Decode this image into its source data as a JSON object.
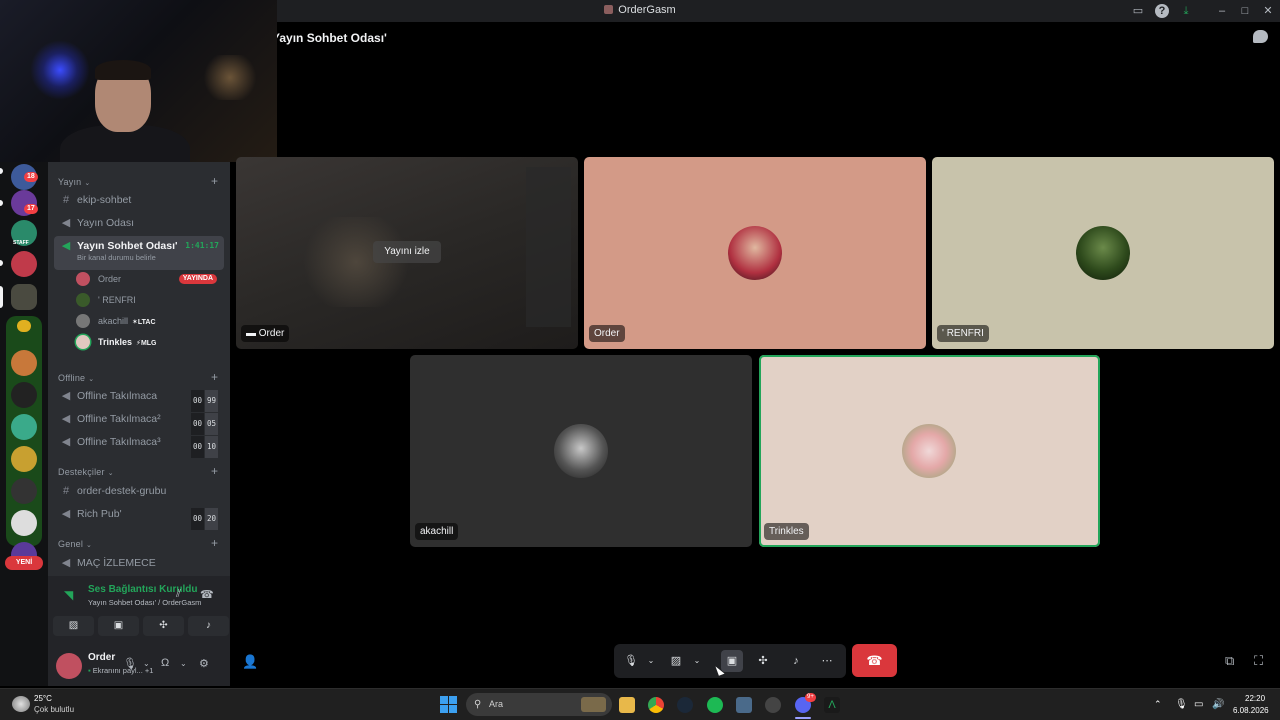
{
  "window": {
    "title": "OrderGasm"
  },
  "voice_header": {
    "channel": "Yayın Sohbet Odası'"
  },
  "sidebar": {
    "categories": [
      {
        "label": "Yayın"
      },
      {
        "label": "Offline"
      },
      {
        "label": "Destekçiler"
      },
      {
        "label": "Genel"
      }
    ],
    "channels": {
      "ekip_sohbet": "ekip-sohbet",
      "yayin_odasi": "Yayın Odası",
      "yayin_sohbet": "Yayın Sohbet Odası'",
      "yayin_sohbet_timer": "1:41:17",
      "yayin_sohbet_status": "Bir kanal durumu belirle",
      "offline1": "Offline Takılmaca",
      "offline2": "Offline Takılmaca²",
      "offline3": "Offline Takılmaca³",
      "order_destek": "order-destek-grubu",
      "rich_pub": "Rich Pub'",
      "mac": "MAÇ İZLEMECE"
    },
    "limits": {
      "offline1": [
        "00",
        "99"
      ],
      "offline2": [
        "00",
        "05"
      ],
      "offline3": [
        "00",
        "10"
      ],
      "rich_pub": [
        "00",
        "20"
      ]
    },
    "voice_users": [
      {
        "name": "Order",
        "badge": "YAYINDA"
      },
      {
        "name": "' RENFRI",
        "badge": ""
      },
      {
        "name": "akachill",
        "badge": "LTAC"
      },
      {
        "name": "Trinkles",
        "badge": "MLG"
      }
    ]
  },
  "servers": {
    "badges": [
      "18",
      "17"
    ],
    "new_label": "YENİ",
    "staff_label": "STAFF"
  },
  "voice_panel": {
    "status": "Ses Bağlantısı Kuruldu",
    "room": "Yayın Sohbet Odası' / OrderGasm"
  },
  "user_panel": {
    "name": "Order",
    "status": "Ekranını payl...",
    "extra": "+1"
  },
  "tiles": [
    {
      "label": "Order",
      "watch": "Yayını izle"
    },
    {
      "label": "Order"
    },
    {
      "label": "' RENFRI"
    },
    {
      "label": "akachill"
    },
    {
      "label": "Trinkles"
    }
  ],
  "taskbar": {
    "temp": "25°C",
    "weather": "Çok bulutlu",
    "search": "Ara",
    "time": "22:20",
    "date": "6.08.2026",
    "discord_badge": "9+"
  },
  "colors": {
    "accent_green": "#23a55a",
    "danger": "#da373c"
  }
}
